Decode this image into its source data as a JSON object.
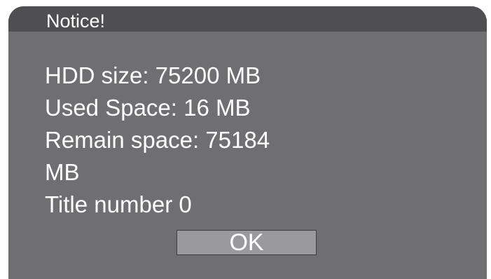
{
  "dialog": {
    "title": "Notice!",
    "lines": [
      "HDD size: 75200 MB",
      "Used Space: 16 MB",
      "Remain space: 75184",
      "MB",
      "Title number 0"
    ],
    "ok_label": "OK"
  },
  "colors": {
    "dialog_background": "#6f6f71",
    "title_bar": "#4f4f51",
    "button_background": "#9a9a9c",
    "text": "#ffffff"
  }
}
